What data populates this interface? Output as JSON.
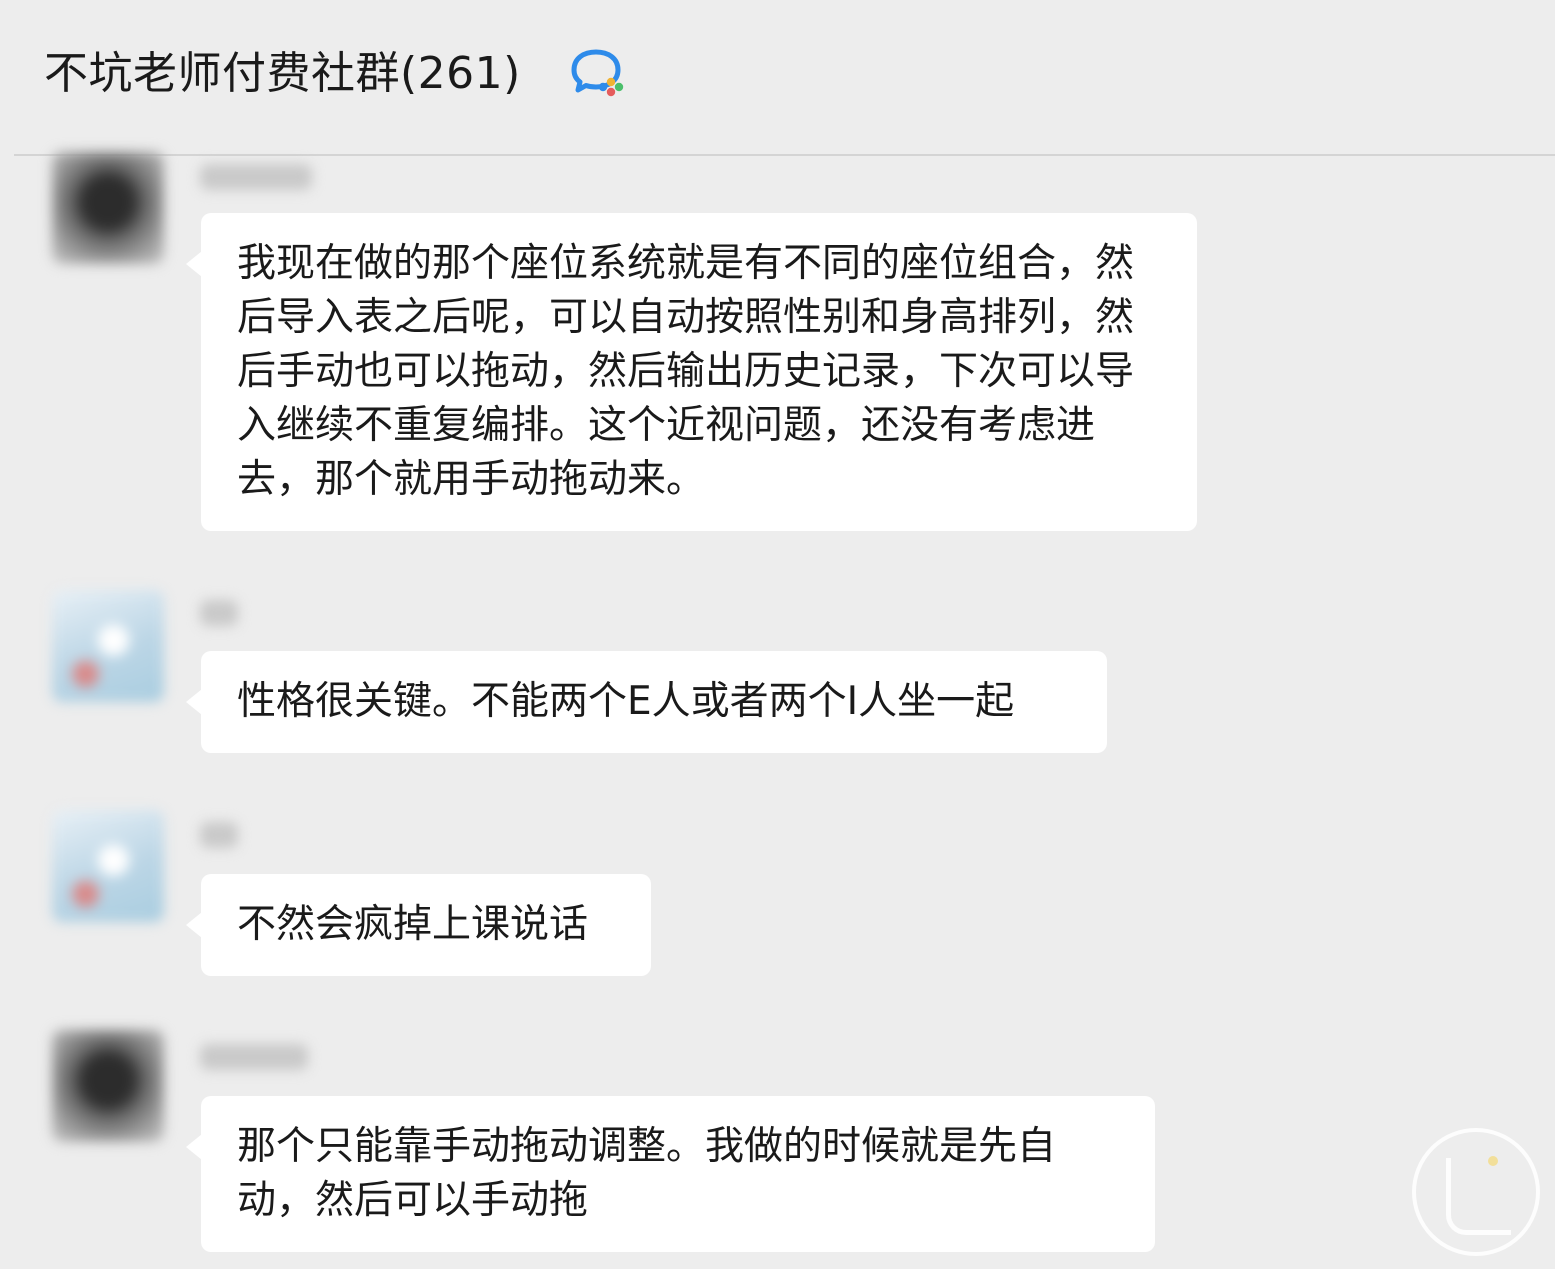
{
  "header": {
    "title": "不坑老师付费社群(261)",
    "icon": "group-chat-icon",
    "icon_colors": [
      "#2e8bea",
      "#f0b334",
      "#4bbf6b",
      "#e55c5c"
    ]
  },
  "messages": [
    {
      "avatar": "blurred-avatar",
      "text": "我现在做的那个座位系统就是有不同的座位组合，然后导入表之后呢，可以自动按照性别和身高排列，然后手动也可以拖动，然后输出历史记录，下次可以导入继续不重复编排。这个近视问题，还没有考虑进去，那个就用手动拖动来。"
    },
    {
      "avatar": "blurred-avatar",
      "text": "性格很关键。不能两个E人或者两个I人坐一起"
    },
    {
      "avatar": "blurred-avatar",
      "text": "不然会疯掉上课说话"
    },
    {
      "avatar": "blurred-avatar",
      "text": "那个只能靠手动拖动调整。我做的时候就是先自动，然后可以手动拖"
    }
  ],
  "theme": {
    "background": "#ededed",
    "bubble": "#ffffff",
    "text": "#1a1a1a"
  }
}
